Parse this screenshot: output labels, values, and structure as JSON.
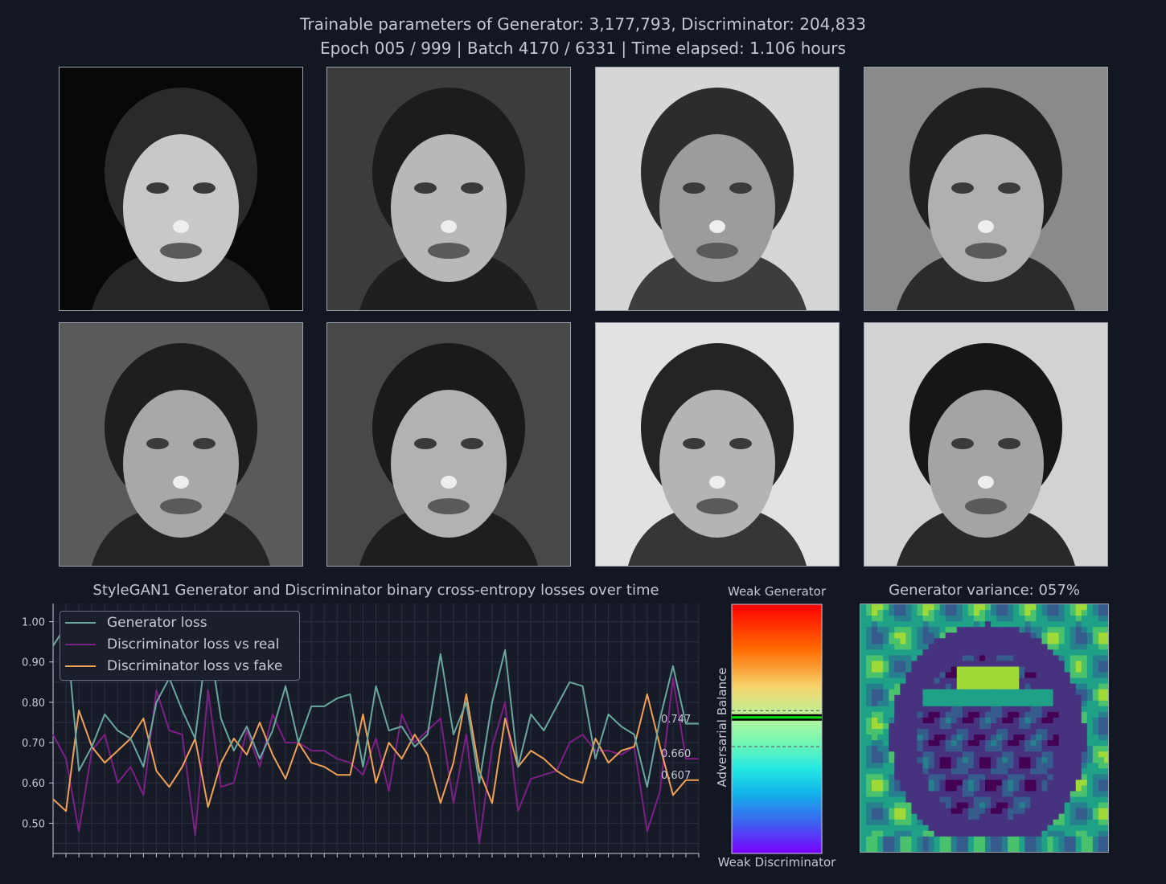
{
  "header": {
    "line1": "Trainable parameters of Generator: 3,177,793, Discriminator: 204,833",
    "line2": "Epoch 005 / 999  |  Batch 4170 / 6331  |  Time elapsed: 1.106 hours"
  },
  "samples": [
    {
      "bg": "#080808",
      "face": "#c8c8c8",
      "hair": "#2a2a2a"
    },
    {
      "bg": "#3c3c3c",
      "face": "#b8b8b8",
      "hair": "#1c1c1c"
    },
    {
      "bg": "#d6d6d6",
      "face": "#9c9c9c",
      "hair": "#2c2c2c"
    },
    {
      "bg": "#8a8a8a",
      "face": "#b0b0b0",
      "hair": "#202020"
    },
    {
      "bg": "#5a5a5a",
      "face": "#a8a8a8",
      "hair": "#1e1e1e"
    },
    {
      "bg": "#484848",
      "face": "#b2b2b2",
      "hair": "#1a1a1a"
    },
    {
      "bg": "#e2e2e2",
      "face": "#b4b4b4",
      "hair": "#242424"
    },
    {
      "bg": "#d2d2d2",
      "face": "#a4a4a4",
      "hair": "#161616"
    }
  ],
  "chart_data": [
    {
      "type": "line",
      "title": "StyleGAN1 Generator and Discriminator binary cross-entropy losses over time",
      "xlabel": "",
      "ylabel": "",
      "ylim": [
        0.425,
        1.045
      ],
      "yticks": [
        "0.50",
        "0.60",
        "0.70",
        "0.80",
        "0.90",
        "1.00"
      ],
      "grid": true,
      "legend_position": "top-left",
      "x": [
        0,
        1,
        2,
        3,
        4,
        5,
        6,
        7,
        8,
        9,
        10,
        11,
        12,
        13,
        14,
        15,
        16,
        17,
        18,
        19,
        20,
        21,
        22,
        23,
        24,
        25,
        26,
        27,
        28,
        29,
        30,
        31,
        32,
        33,
        34,
        35,
        36,
        37,
        38,
        39,
        40,
        41,
        42,
        43,
        44,
        45,
        46,
        47,
        48,
        49,
        50
      ],
      "series": [
        {
          "name": "Generator loss",
          "color": "#6aa79f",
          "values": [
            0.94,
            0.99,
            0.63,
            0.69,
            0.77,
            0.73,
            0.71,
            0.64,
            0.8,
            0.86,
            0.78,
            0.71,
            0.97,
            0.76,
            0.68,
            0.74,
            0.66,
            0.73,
            0.84,
            0.7,
            0.79,
            0.79,
            0.81,
            0.82,
            0.64,
            0.84,
            0.73,
            0.74,
            0.69,
            0.72,
            0.92,
            0.72,
            0.8,
            0.6,
            0.8,
            0.93,
            0.64,
            0.77,
            0.73,
            0.79,
            0.85,
            0.84,
            0.66,
            0.77,
            0.74,
            0.72,
            0.59,
            0.76,
            0.89,
            0.747,
            0.747
          ]
        },
        {
          "name": "Discriminator loss vs real",
          "color": "#7d1f86",
          "values": [
            0.72,
            0.66,
            0.48,
            0.68,
            0.72,
            0.6,
            0.64,
            0.57,
            0.83,
            0.73,
            0.72,
            0.47,
            0.83,
            0.59,
            0.6,
            0.73,
            0.64,
            0.77,
            0.7,
            0.7,
            0.68,
            0.68,
            0.66,
            0.65,
            0.62,
            0.71,
            0.58,
            0.77,
            0.7,
            0.73,
            0.76,
            0.55,
            0.72,
            0.45,
            0.69,
            0.8,
            0.53,
            0.61,
            0.62,
            0.63,
            0.7,
            0.72,
            0.68,
            0.68,
            0.67,
            0.69,
            0.48,
            0.58,
            0.86,
            0.66,
            0.66
          ]
        },
        {
          "name": "Discriminator loss vs fake",
          "color": "#f2a155",
          "values": [
            0.56,
            0.53,
            0.78,
            0.69,
            0.65,
            0.68,
            0.71,
            0.76,
            0.63,
            0.59,
            0.64,
            0.71,
            0.54,
            0.65,
            0.71,
            0.67,
            0.75,
            0.67,
            0.61,
            0.7,
            0.65,
            0.64,
            0.62,
            0.62,
            0.77,
            0.6,
            0.7,
            0.66,
            0.72,
            0.67,
            0.55,
            0.65,
            0.82,
            0.63,
            0.55,
            0.76,
            0.64,
            0.68,
            0.66,
            0.63,
            0.61,
            0.6,
            0.71,
            0.65,
            0.68,
            0.69,
            0.82,
            0.69,
            0.57,
            0.607,
            0.607
          ]
        }
      ],
      "end_labels": [
        "0.747",
        "0.660",
        "0.607"
      ]
    },
    {
      "type": "bar",
      "title": "Adversarial Balance",
      "top_label": "Weak Generator",
      "bottom_label": "Weak Discriminator",
      "balance_value": 0.546,
      "upper_band": 0.573,
      "lower_band": 0.429
    },
    {
      "type": "heatmap",
      "title": "Generator variance: 057%",
      "variance_percent": 57
    }
  ]
}
